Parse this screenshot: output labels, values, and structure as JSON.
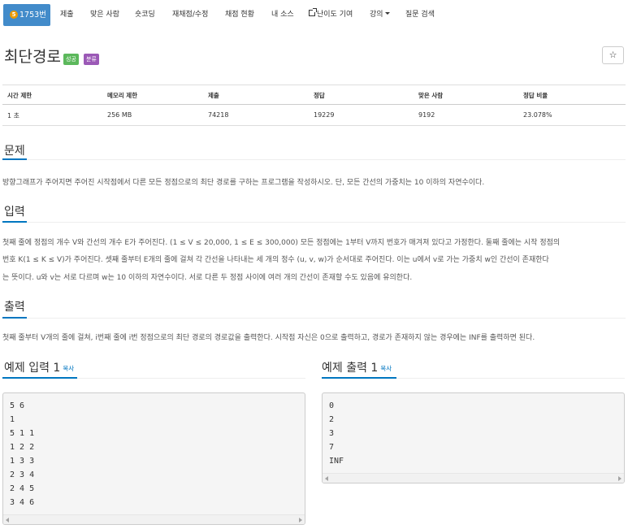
{
  "nav": {
    "problem_number": "1753번",
    "tier_badge": "5",
    "items": [
      "제출",
      "맞은 사람",
      "숏코딩",
      "재채점/수정",
      "채점 현황",
      "내 소스",
      "난이도 기여",
      "강의",
      "질문 검색"
    ]
  },
  "problem": {
    "title": "최단경로",
    "labels": [
      "성공",
      "분류"
    ],
    "star_icon": "☆"
  },
  "info_table": {
    "headers": [
      "시간 제한",
      "메모리 제한",
      "제출",
      "정답",
      "맞은 사람",
      "정답 비율"
    ],
    "values": [
      "1 초",
      "256 MB",
      "74218",
      "19229",
      "9192",
      "23.078%"
    ]
  },
  "sections": {
    "description_title": "문제",
    "description": "방향그래프가 주어지면 주어진 시작점에서 다른 모든 정점으로의 최단 경로를 구하는 프로그램을 작성하시오. 단, 모든 간선의 가중치는 10 이하의 자연수이다.",
    "input_title": "입력",
    "input_lines": [
      "첫째 줄에 정점의 개수 V와 간선의 개수 E가 주어진다. (1 ≤ V ≤ 20,000, 1 ≤ E ≤ 300,000) 모든 정점에는 1부터 V까지 번호가 매겨져 있다고 가정한다. 둘째 줄에는 시작 정점의",
      "번호 K(1 ≤ K ≤ V)가 주어진다. 셋째 줄부터 E개의 줄에 걸쳐 각 간선을 나타내는 세 개의 정수 (u, v, w)가 순서대로 주어진다. 이는 u에서 v로 가는 가중치 w인 간선이 존재한다",
      "는 뜻이다. u와 v는 서로 다르며 w는 10 이하의 자연수이다. 서로 다른 두 정점 사이에 여러 개의 간선이 존재할 수도 있음에 유의한다."
    ],
    "output_title": "출력",
    "output": "첫째 줄부터 V개의 줄에 걸쳐, i번째 줄에 i번 정점으로의 최단 경로의 경로값을 출력한다. 시작점 자신은 0으로 출력하고, 경로가 존재하지 않는 경우에는 INF를 출력하면 된다."
  },
  "samples": {
    "input_title": "예제 입력 1",
    "output_title": "예제 출력 1",
    "copy_label": "복사",
    "input_lines": [
      "5 6",
      "1",
      "5 1 1",
      "1 2 2",
      "1 3 3",
      "2 3 4",
      "2 4 5",
      "3 4 6"
    ],
    "output_lines": [
      "0",
      "2",
      "3",
      "7",
      "INF"
    ]
  }
}
